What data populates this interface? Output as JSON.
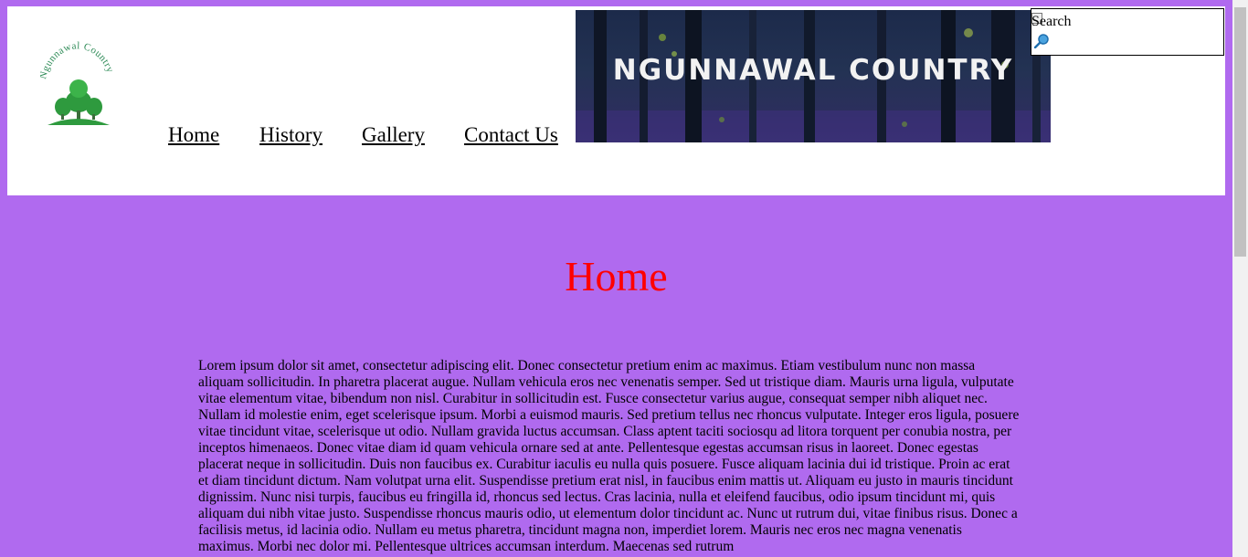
{
  "header": {
    "logo_text": "Ngunnawal Country",
    "nav": [
      {
        "label": "Home"
      },
      {
        "label": "History"
      },
      {
        "label": "Gallery"
      },
      {
        "label": "Contact Us"
      }
    ],
    "banner_title": "NGUNNAWAL COUNTRY"
  },
  "search": {
    "label": "Search",
    "icon": "magnifier-icon"
  },
  "main": {
    "title": "Home",
    "paragraph": "Lorem ipsum dolor sit amet, consectetur adipiscing elit. Donec consectetur pretium enim ac maximus. Etiam vestibulum nunc non massa aliquam sollicitudin. In pharetra placerat augue. Nullam vehicula eros nec venenatis semper. Sed ut tristique diam. Mauris urna ligula, vulputate vitae elementum vitae, bibendum non nisl. Curabitur in sollicitudin est. Fusce consectetur varius augue, consequat semper nibh aliquet nec. Nullam id molestie enim, eget scelerisque ipsum. Morbi a euismod mauris. Sed pretium tellus nec rhoncus vulputate. Integer eros ligula, posuere vitae tincidunt vitae, scelerisque ut odio. Nullam gravida luctus accumsan. Class aptent taciti sociosqu ad litora torquent per conubia nostra, per inceptos himenaeos. Donec vitae diam id quam vehicula ornare sed at ante. Pellentesque egestas accumsan risus in laoreet. Donec egestas placerat neque in sollicitudin. Duis non faucibus ex. Curabitur iaculis eu nulla quis posuere. Fusce aliquam lacinia dui id tristique. Proin ac erat et diam tincidunt dictum. Nam volutpat urna elit. Suspendisse pretium erat nisl, in faucibus enim mattis ut. Aliquam eu justo in mauris tincidunt dignissim. Nunc nisi turpis, faucibus eu fringilla id, rhoncus sed lectus. Cras lacinia, nulla et eleifend faucibus, odio ipsum tincidunt mi, quis aliquam dui nibh vitae justo. Suspendisse rhoncus mauris odio, ut elementum dolor tincidunt ac. Nunc ut rutrum dui, vitae finibus risus. Donec a facilisis metus, id lacinia odio. Nullam eu metus pharetra, tincidunt magna non, imperdiet lorem. Mauris nec eros nec magna venenatis maximus. Morbi nec dolor mi. Pellentesque ultrices accumsan interdum. Maecenas sed rutrum"
  },
  "colors": {
    "page_background": "#b06aef",
    "title": "#ff0000",
    "header_background": "#ffffff"
  }
}
